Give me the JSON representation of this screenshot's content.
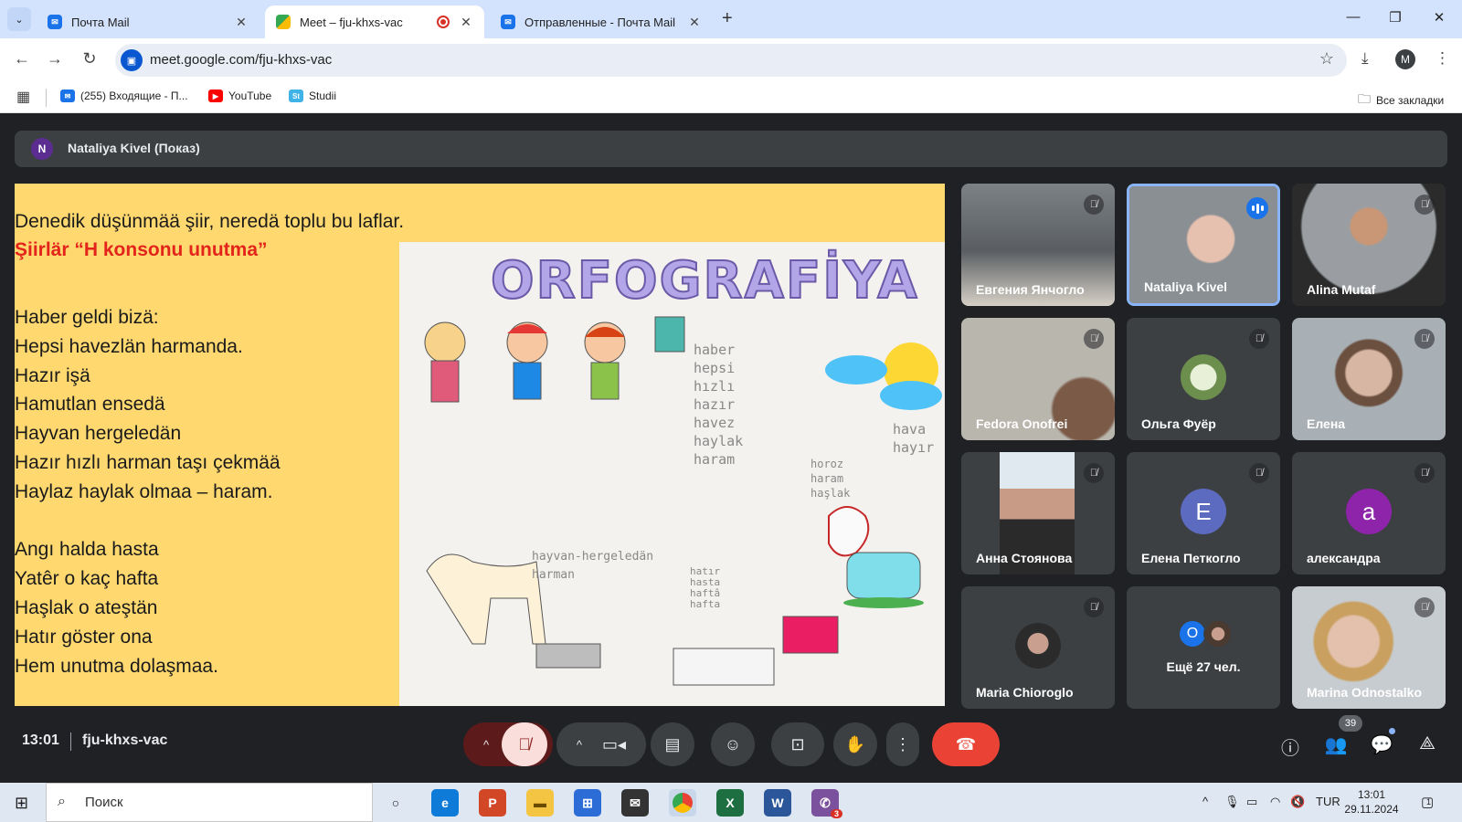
{
  "browser": {
    "tabs": [
      {
        "title": "Почта Mail",
        "icon": "mail-icon",
        "active": false
      },
      {
        "title": "Meet – fju-khxs-vac",
        "icon": "meet-icon",
        "active": true,
        "recording": true
      },
      {
        "title": "Отправленные - Почта Mail",
        "icon": "mail-icon",
        "active": false
      }
    ],
    "url": "meet.google.com/fju-khxs-vac",
    "profile_initial": "M",
    "bookmarks": [
      {
        "label": "(255) Входящие - П...",
        "icon": "mail-icon"
      },
      {
        "label": "YouTube",
        "icon": "youtube-icon"
      },
      {
        "label": "Studii",
        "icon": "studii-icon"
      }
    ],
    "all_bookmarks": "Все закладки"
  },
  "meet": {
    "presenter": {
      "initial": "N",
      "label": "Nataliya Kivel (Показ)"
    },
    "slide": {
      "line1": "Denedik düşünmää şiir, neredä toplu bu laflar.",
      "line2": "Şiirlär “H konsonu unutma”",
      "poem": [
        "Haber geldi bizä:",
        "Hepsi havezlän harmanda.",
        "Hazır işä",
        "Hamutlan ensedä",
        "Hayvan hergeledän",
        "Hazır hızlı harman taşı çekmää",
        "Haylaz haylak olmaa – haram.",
        "",
        "Angı halda hasta",
        "Yatêr o kaç hafta",
        "Haşlak o ateştän",
        "Hatır göster ona",
        "Hem unutma dolaşmaa."
      ],
      "drawing": {
        "title": "ORFOGRAFİYA",
        "words_col1": [
          "haber",
          "hepsi",
          "hızlı",
          "hazır",
          "havez",
          "haylak",
          "haram"
        ],
        "words_col2": [
          "hava",
          "hayır"
        ],
        "words_col3": [
          "horoz",
          "haram",
          "haşlak"
        ],
        "words_col4": [
          "hayvan-hergeledän",
          "harman"
        ],
        "words_col5": [
          "hatır",
          "hasta",
          "haftâ",
          "hafta"
        ]
      }
    },
    "participants": [
      {
        "name": "Евгения Янчогло",
        "muted": true,
        "kind": "video",
        "bg": "#6b6f72"
      },
      {
        "name": "Nataliya Kivel",
        "muted": false,
        "speaking": true,
        "kind": "video",
        "bg": "#8a8f94"
      },
      {
        "name": "Alina Mutaf",
        "muted": true,
        "kind": "video",
        "bg": "#9a9ea2"
      },
      {
        "name": "Fedora Onofrei",
        "muted": true,
        "kind": "video",
        "bg": "#b9b6ae"
      },
      {
        "name": "Ольга Фуёр",
        "muted": true,
        "kind": "photo",
        "bg": "#3c4043"
      },
      {
        "name": "Елена",
        "muted": true,
        "kind": "video",
        "bg": "#a8b0b5"
      },
      {
        "name": "Анна Стоянова",
        "muted": true,
        "kind": "video",
        "bg": "#3c4043"
      },
      {
        "name": "Елена Петкогло",
        "muted": true,
        "kind": "letter",
        "letter": "E",
        "color": "#5c6bc0"
      },
      {
        "name": "александра",
        "muted": true,
        "kind": "letter",
        "letter": "a",
        "color": "#8e24aa"
      },
      {
        "name": "Maria Chioroglo",
        "muted": true,
        "kind": "photo",
        "bg": "#3c4043"
      },
      {
        "name": "Ещё 27 чел.",
        "muted": false,
        "kind": "more",
        "letter": "O"
      },
      {
        "name": "Marina Odnostalko",
        "muted": true,
        "kind": "video",
        "bg": "#c7ccd1"
      }
    ],
    "bottom": {
      "time": "13:01",
      "meeting_code": "fju-khxs-vac",
      "people_count": "39"
    }
  },
  "taskbar": {
    "search_placeholder": "Поиск",
    "language": "TUR",
    "time": "13:01",
    "date": "29.11.2024",
    "viber_badge": "3",
    "notification_count": "1"
  },
  "colors": {
    "meet_bg": "#202124",
    "tile_bg": "#3c4043",
    "slide_bg": "#ffd970",
    "end_call": "#ea4335",
    "accent_blue": "#1a73e8"
  }
}
